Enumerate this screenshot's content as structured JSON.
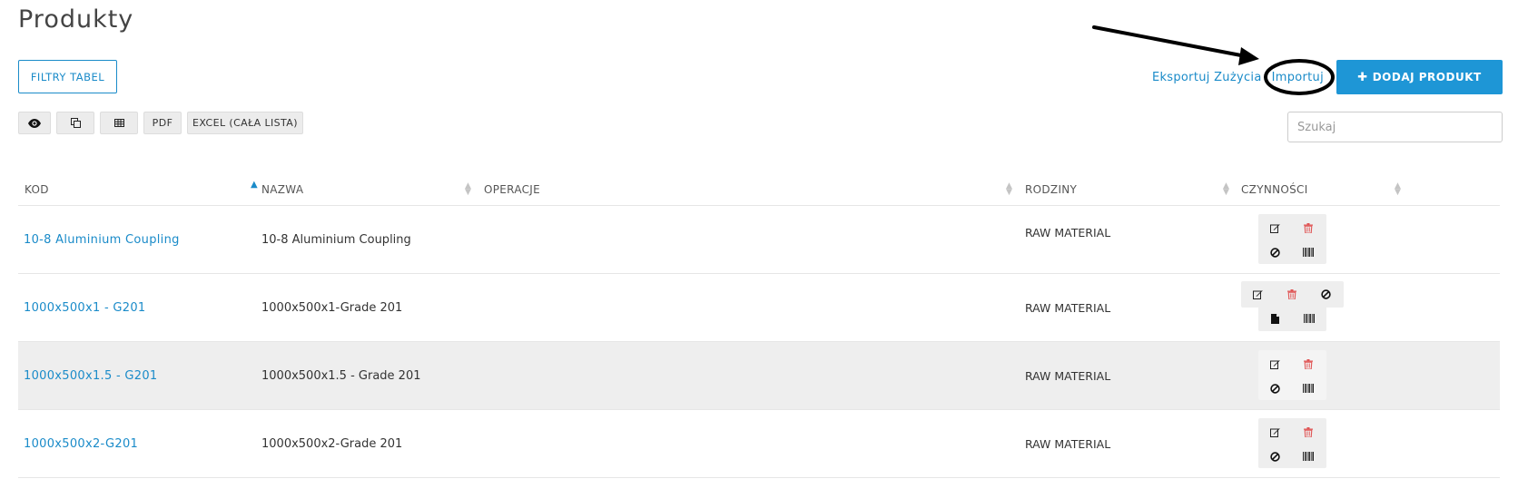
{
  "page": {
    "title": "Produkty"
  },
  "toolbar": {
    "filters_label": "FILTRY TABEL",
    "export_usage_label": "Eksportuj Zużycia",
    "import_label": "Importuj",
    "add_product_label": "DODAJ PRODUKT",
    "add_product_icon": "plus-icon",
    "accent_color": "#1e96d6"
  },
  "export_buttons": [
    {
      "icon": "eye-icon"
    },
    {
      "icon": "copy-icon"
    },
    {
      "icon": "table-icon"
    },
    {
      "label": "PDF"
    },
    {
      "label": "EXCEL (CAŁA LISTA)"
    }
  ],
  "search": {
    "placeholder": "Szukaj"
  },
  "table": {
    "columns": [
      {
        "label": "KOD",
        "sort": "asc"
      },
      {
        "label": "NAZWA",
        "sort": "both"
      },
      {
        "label": "OPERACJE",
        "sort": "both"
      },
      {
        "label": "RODZINY",
        "sort": "both"
      },
      {
        "label": "CZYNNOŚCI",
        "sort": "both"
      }
    ],
    "rows": [
      {
        "code": "10-8 Aluminium Coupling",
        "name": "10-8 Aluminium Coupling",
        "operations": "",
        "family": "RAW MATERIAL",
        "actions": [
          "edit-icon",
          "trash-icon",
          "disable-icon",
          "barcode-icon"
        ]
      },
      {
        "code": "1000x500x1 - G201",
        "name": "1000x500x1-Grade 201",
        "operations": "",
        "family": "RAW MATERIAL",
        "actions": [
          "edit-icon",
          "trash-icon",
          "disable-icon",
          "file-icon",
          "barcode-icon"
        ]
      },
      {
        "code": "1000x500x1.5 - G201",
        "name": "1000x500x1.5 - Grade 201",
        "operations": "",
        "family": "RAW MATERIAL",
        "actions": [
          "edit-icon",
          "trash-icon",
          "disable-icon",
          "barcode-icon"
        ]
      },
      {
        "code": "1000x500x2-G201",
        "name": "1000x500x2-Grade 201",
        "operations": "",
        "family": "RAW MATERIAL",
        "actions": [
          "edit-icon",
          "trash-icon",
          "disable-icon",
          "barcode-icon"
        ]
      }
    ]
  }
}
